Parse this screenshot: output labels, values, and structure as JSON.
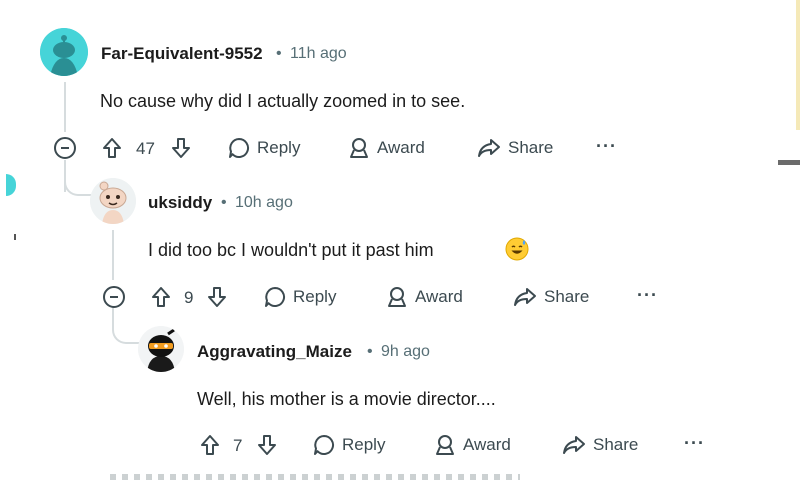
{
  "comments": [
    {
      "username": "Far-Equivalent-9552",
      "separator": "•",
      "time": "11h ago",
      "text": "No cause why did I actually zoomed in to see.",
      "votes": "47",
      "reply_label": "Reply",
      "award_label": "Award",
      "share_label": "Share",
      "more_label": "···"
    },
    {
      "username": "uksiddy",
      "separator": "•",
      "time": "10h ago",
      "text": "I did too bc I wouldn't put it past him",
      "votes": "9",
      "reply_label": "Reply",
      "award_label": "Award",
      "share_label": "Share",
      "more_label": "···"
    },
    {
      "username": "Aggravating_Maize",
      "separator": "•",
      "time": "9h ago",
      "text": "Well, his mother is a movie director....",
      "votes": "7",
      "reply_label": "Reply",
      "award_label": "Award",
      "share_label": "Share",
      "more_label": "···"
    }
  ],
  "colors": {
    "accent_teal": "#46d4d8",
    "meta_gray": "#576f76",
    "icon_gray": "#3c4a50",
    "thread_line": "#d6dcde"
  },
  "icons": [
    "upvote-icon",
    "downvote-icon",
    "reply-bubble-icon",
    "award-icon",
    "share-arrow-icon",
    "collapse-icon",
    "more-icon",
    "emoji-sweat-smile-icon"
  ]
}
